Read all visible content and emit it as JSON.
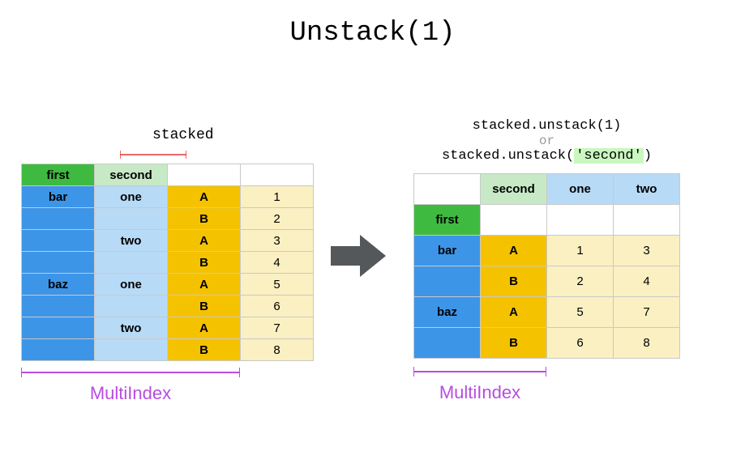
{
  "title": "Unstack(1)",
  "left": {
    "label": "stacked",
    "headers": {
      "first": "first",
      "second": "second"
    },
    "rows": [
      {
        "first": "bar",
        "second": "one",
        "k": "A",
        "v": "1"
      },
      {
        "first": "",
        "second": "",
        "k": "B",
        "v": "2"
      },
      {
        "first": "",
        "second": "two",
        "k": "A",
        "v": "3"
      },
      {
        "first": "",
        "second": "",
        "k": "B",
        "v": "4"
      },
      {
        "first": "baz",
        "second": "one",
        "k": "A",
        "v": "5"
      },
      {
        "first": "",
        "second": "",
        "k": "B",
        "v": "6"
      },
      {
        "first": "",
        "second": "two",
        "k": "A",
        "v": "7"
      },
      {
        "first": "",
        "second": "",
        "k": "B",
        "v": "8"
      }
    ],
    "multiindex": "MultiIndex"
  },
  "right": {
    "code1": "stacked.unstack(1)",
    "or": "or",
    "code2_pre": "stacked.unstack(",
    "code2_hl": "'second'",
    "code2_post": ")",
    "col_header_name": "second",
    "cols": {
      "one": "one",
      "two": "two"
    },
    "row_header_name": "first",
    "rows": [
      {
        "first": "bar",
        "k": "A",
        "one": "1",
        "two": "3"
      },
      {
        "first": "",
        "k": "B",
        "one": "2",
        "two": "4"
      },
      {
        "first": "baz",
        "k": "A",
        "one": "5",
        "two": "7"
      },
      {
        "first": "",
        "k": "B",
        "one": "6",
        "two": "8"
      }
    ],
    "multiindex": "MultiIndex"
  },
  "colors": {
    "green": "#3fba41",
    "lightgreen": "#c7e9c6",
    "blue": "#3d95e8",
    "lightblue": "#b7daf6",
    "gold": "#f5c200",
    "pale": "#faf0c2",
    "purple": "#b84de0",
    "arrow": "#54585b",
    "red": "#e23838"
  }
}
